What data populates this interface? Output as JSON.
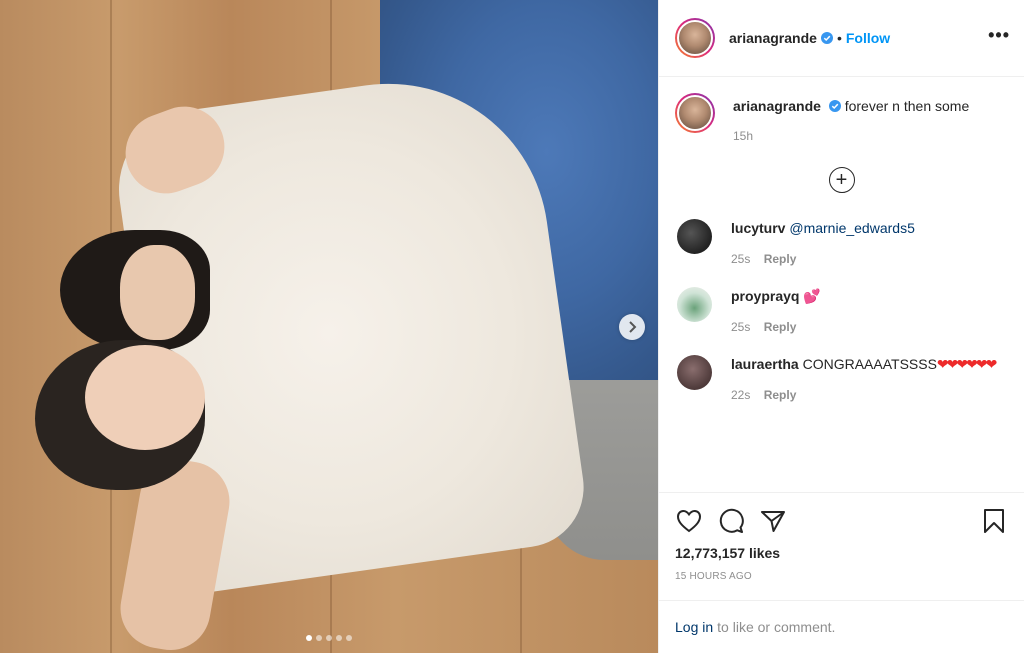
{
  "post": {
    "author": "arianagrande",
    "follow_label": "Follow",
    "separator": "•",
    "more_label": "•••",
    "caption": "forever n then some",
    "caption_time": "15h",
    "likes": "12,773,157 likes",
    "time_ago": "15 HOURS AGO",
    "carousel": {
      "total": 5,
      "active": 1
    }
  },
  "load_more_symbol": "+",
  "comments": [
    {
      "user": "lucyturv",
      "mention": "@marnie_edwards5",
      "text": "",
      "time": "25s",
      "reply": "Reply",
      "avatar_color": "#2b2b2b"
    },
    {
      "user": "proyprayq",
      "mention": "",
      "text": "💕",
      "time": "25s",
      "reply": "Reply",
      "avatar_color": "#cfe3d6"
    },
    {
      "user": "lauraertha",
      "mention": "",
      "text": "CONGRAAAATSSSS",
      "hearts": "❤❤❤❤❤❤",
      "time": "22s",
      "reply": "Reply",
      "avatar_color": "#5a4444"
    }
  ],
  "login": {
    "link": "Log in",
    "text": "to like or comment."
  },
  "colors": {
    "link_blue": "#0095f6",
    "text": "#262626",
    "muted": "#8e8e8e",
    "heart_red": "#ed2a2a"
  },
  "icons": [
    "verified-badge-icon",
    "heart-icon",
    "comment-icon",
    "share-icon",
    "bookmark-icon",
    "chevron-right-icon",
    "more-icon",
    "plus-circle-icon"
  ]
}
